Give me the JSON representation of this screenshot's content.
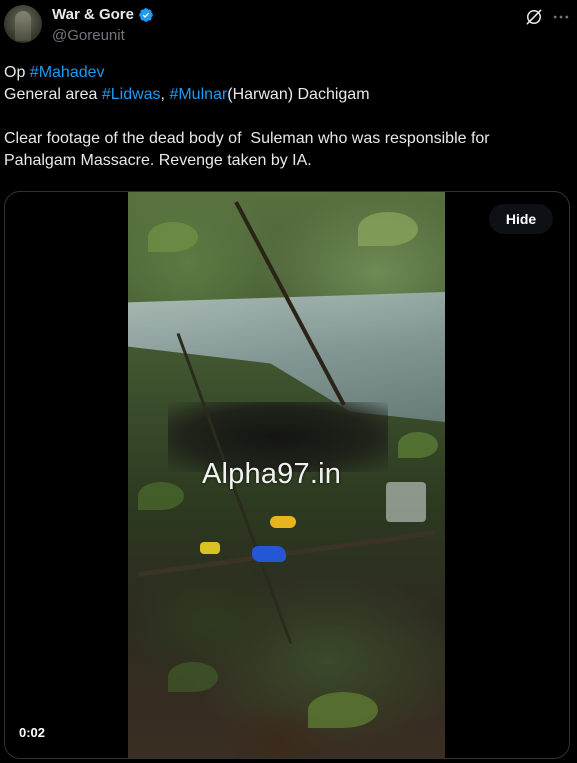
{
  "tweet": {
    "author": {
      "display_name": "War & Gore",
      "handle": "@Goreunit",
      "verified": true
    },
    "text": {
      "line1_prefix": "Op ",
      "line1_hashtag": "#Mahadev",
      "line2_prefix": "General area ",
      "line2_hashtag1": "#Lidwas",
      "line2_sep": ", ",
      "line2_hashtag2": "#Mulnar",
      "line2_suffix": "(Harwan) Dachigam",
      "line3": "Clear footage of the dead body of  Suleman who was responsible for",
      "line4": "Pahalgam Massacre. Revenge taken by IA."
    },
    "media": {
      "watermark": "Alpha97.in",
      "hide_label": "Hide",
      "timestamp": "0:02"
    }
  },
  "icons": {
    "verified": "verified-badge-icon",
    "grok": "grok-icon",
    "more": "more-icon"
  },
  "colors": {
    "background": "#000000",
    "text": "#e7e9ea",
    "secondary_text": "#71767b",
    "link": "#1d9bf0",
    "verified": "#1d9bf0",
    "border": "#2f3336"
  }
}
